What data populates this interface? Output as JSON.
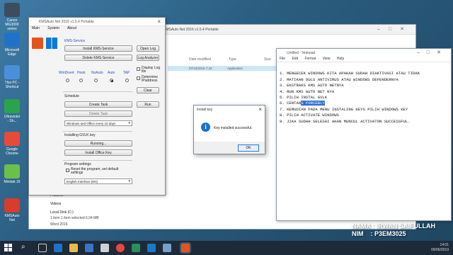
{
  "desktop": {
    "icons": [
      {
        "label": "Canon\nMG3000\nseries",
        "color": "#3b4d5f"
      },
      {
        "label": "Microsoft\nEdge",
        "color": "#1f72c8"
      },
      {
        "label": "This PC -\nShortcut",
        "color": "#4a90d9"
      },
      {
        "label": "Ultraviolet\n- Sh...",
        "color": "#2aa34a"
      },
      {
        "label": "Google\nChrome",
        "color": "#e64a3b"
      },
      {
        "label": "Minitab 16",
        "color": "#6cc04a"
      },
      {
        "label": "KMSAuto\nNet",
        "color": "#d93b2e"
      }
    ]
  },
  "explorer": {
    "title": "KMSAuto Net 2016 v1.5.4 Portable",
    "columns": [
      "Date modified",
      "Type",
      "Size"
    ],
    "selected_row": {
      "date": "07/10/2016 7:43",
      "type": "Application"
    },
    "nav_items": [
      "Pictures",
      "Videos",
      "Local Disk (C:)"
    ],
    "status": "1 item    1 item selected  6,04 MB",
    "status2": "Word 2019"
  },
  "kms": {
    "title": "KMSAuto Net 2016 v1.5.4 Portable",
    "tabs": [
      "Main",
      "System",
      "About"
    ],
    "kms_service_label": "KMS-Service",
    "install_service_btn": "Install KMS-Service",
    "delete_service_btn": "Delete KMS-Service",
    "open_log_btn": "Open Log",
    "log_analyzer_btn": "Log Analyzer",
    "modes": [
      "WinDivert",
      "Hook",
      "NoAuto",
      "Auto",
      "TAP"
    ],
    "display_log_label": "Display Log file",
    "determine_ip_label": "Determine IPaddress",
    "clear_btn": "Clear",
    "run_btn": "Run",
    "schedule_label": "Schedule",
    "create_task_btn": "Create Task",
    "delete_task_btn": "Delete Task",
    "task_select": "Windows and Office every 10 days",
    "installing_gvlk_label": "Installing GVLK key",
    "running_btn": "Running...",
    "install_office_key_btn": "Install Office Key",
    "program_settings_label": "Program settings",
    "reset_label": "Reset the program, set default settings",
    "language_select": "English Interface (EN)"
  },
  "notepad": {
    "title": "Untitled - Notepad",
    "menu": [
      "File",
      "Edit",
      "Format",
      "View",
      "Help"
    ],
    "lines": [
      "1. MENGECEK WINDOWS KITA APAKAH SUDAH DIAKTIVASI ATAU TIDAK",
      "2. MATIKAN DULU ANTIVIRUS ATAU WINDOWS DEFENDERNYA",
      "3. EKSTRAKS KMS AUTO NETNYA",
      "4. RUN KMS AUTO NET NYA",
      "5. PILIH INSTAL GVLK",
      "6. CENTANG FORCEBLY",
      "7. KEMUDIAN PADA MENU INSTALING KEYS PILIH WINDOWS KEY",
      "8. PILIH ACTIVATE WINDOWS",
      "9. JIKA SUDAH SELESAI AKAN MUNCUL ACTIVATON SUCCESSFUL."
    ],
    "line6_prefix": "6. CENTAN",
    "line6_selected": "G FORCEBLY"
  },
  "dialog": {
    "title": "Install key",
    "message": "Key installed successful.",
    "ok_label": "OK"
  },
  "overlay": {
    "name_line": "NAMA : IRWAN SAIFULLAH",
    "nim_line": "NIM    : P3EM3025"
  },
  "taskbar": {
    "time": "14:01",
    "date": "09/06/2019"
  },
  "colors": {
    "desktop": "#2b5d80",
    "taskbar": "#1d2a3a",
    "selection": "#2b6fd4",
    "info_icon": "#1c6fd1"
  }
}
